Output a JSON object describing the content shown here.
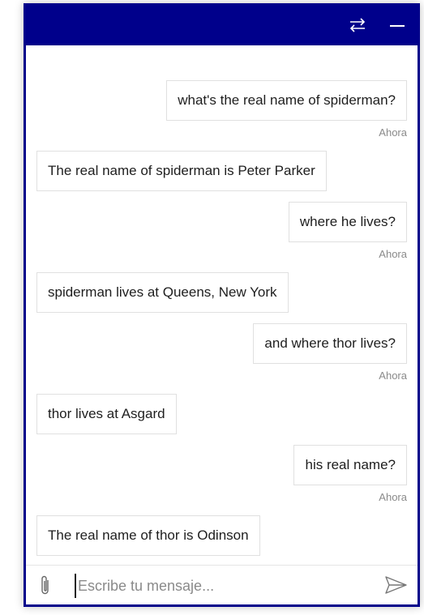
{
  "header": {
    "swap_icon": "swap-arrows-icon",
    "minimize_icon": "minimize-icon",
    "background": "#00008b"
  },
  "messages": [
    {
      "role": "user",
      "text": "what's the real name of spiderman?",
      "time": "Ahora"
    },
    {
      "role": "bot",
      "text": "The real name of spiderman is Peter Parker"
    },
    {
      "role": "user",
      "text": "where he lives?",
      "time": "Ahora"
    },
    {
      "role": "bot",
      "text": "spiderman lives at Queens, New York"
    },
    {
      "role": "user",
      "text": "and where thor lives?",
      "time": "Ahora"
    },
    {
      "role": "bot",
      "text": "thor lives at Asgard"
    },
    {
      "role": "user",
      "text": "his real name?",
      "time": "Ahora"
    },
    {
      "role": "bot",
      "text": "The real name of thor is Odinson"
    }
  ],
  "input": {
    "placeholder": "Escribe tu mensaje...",
    "value": "",
    "attach_icon": "paperclip-icon",
    "send_icon": "send-icon"
  }
}
